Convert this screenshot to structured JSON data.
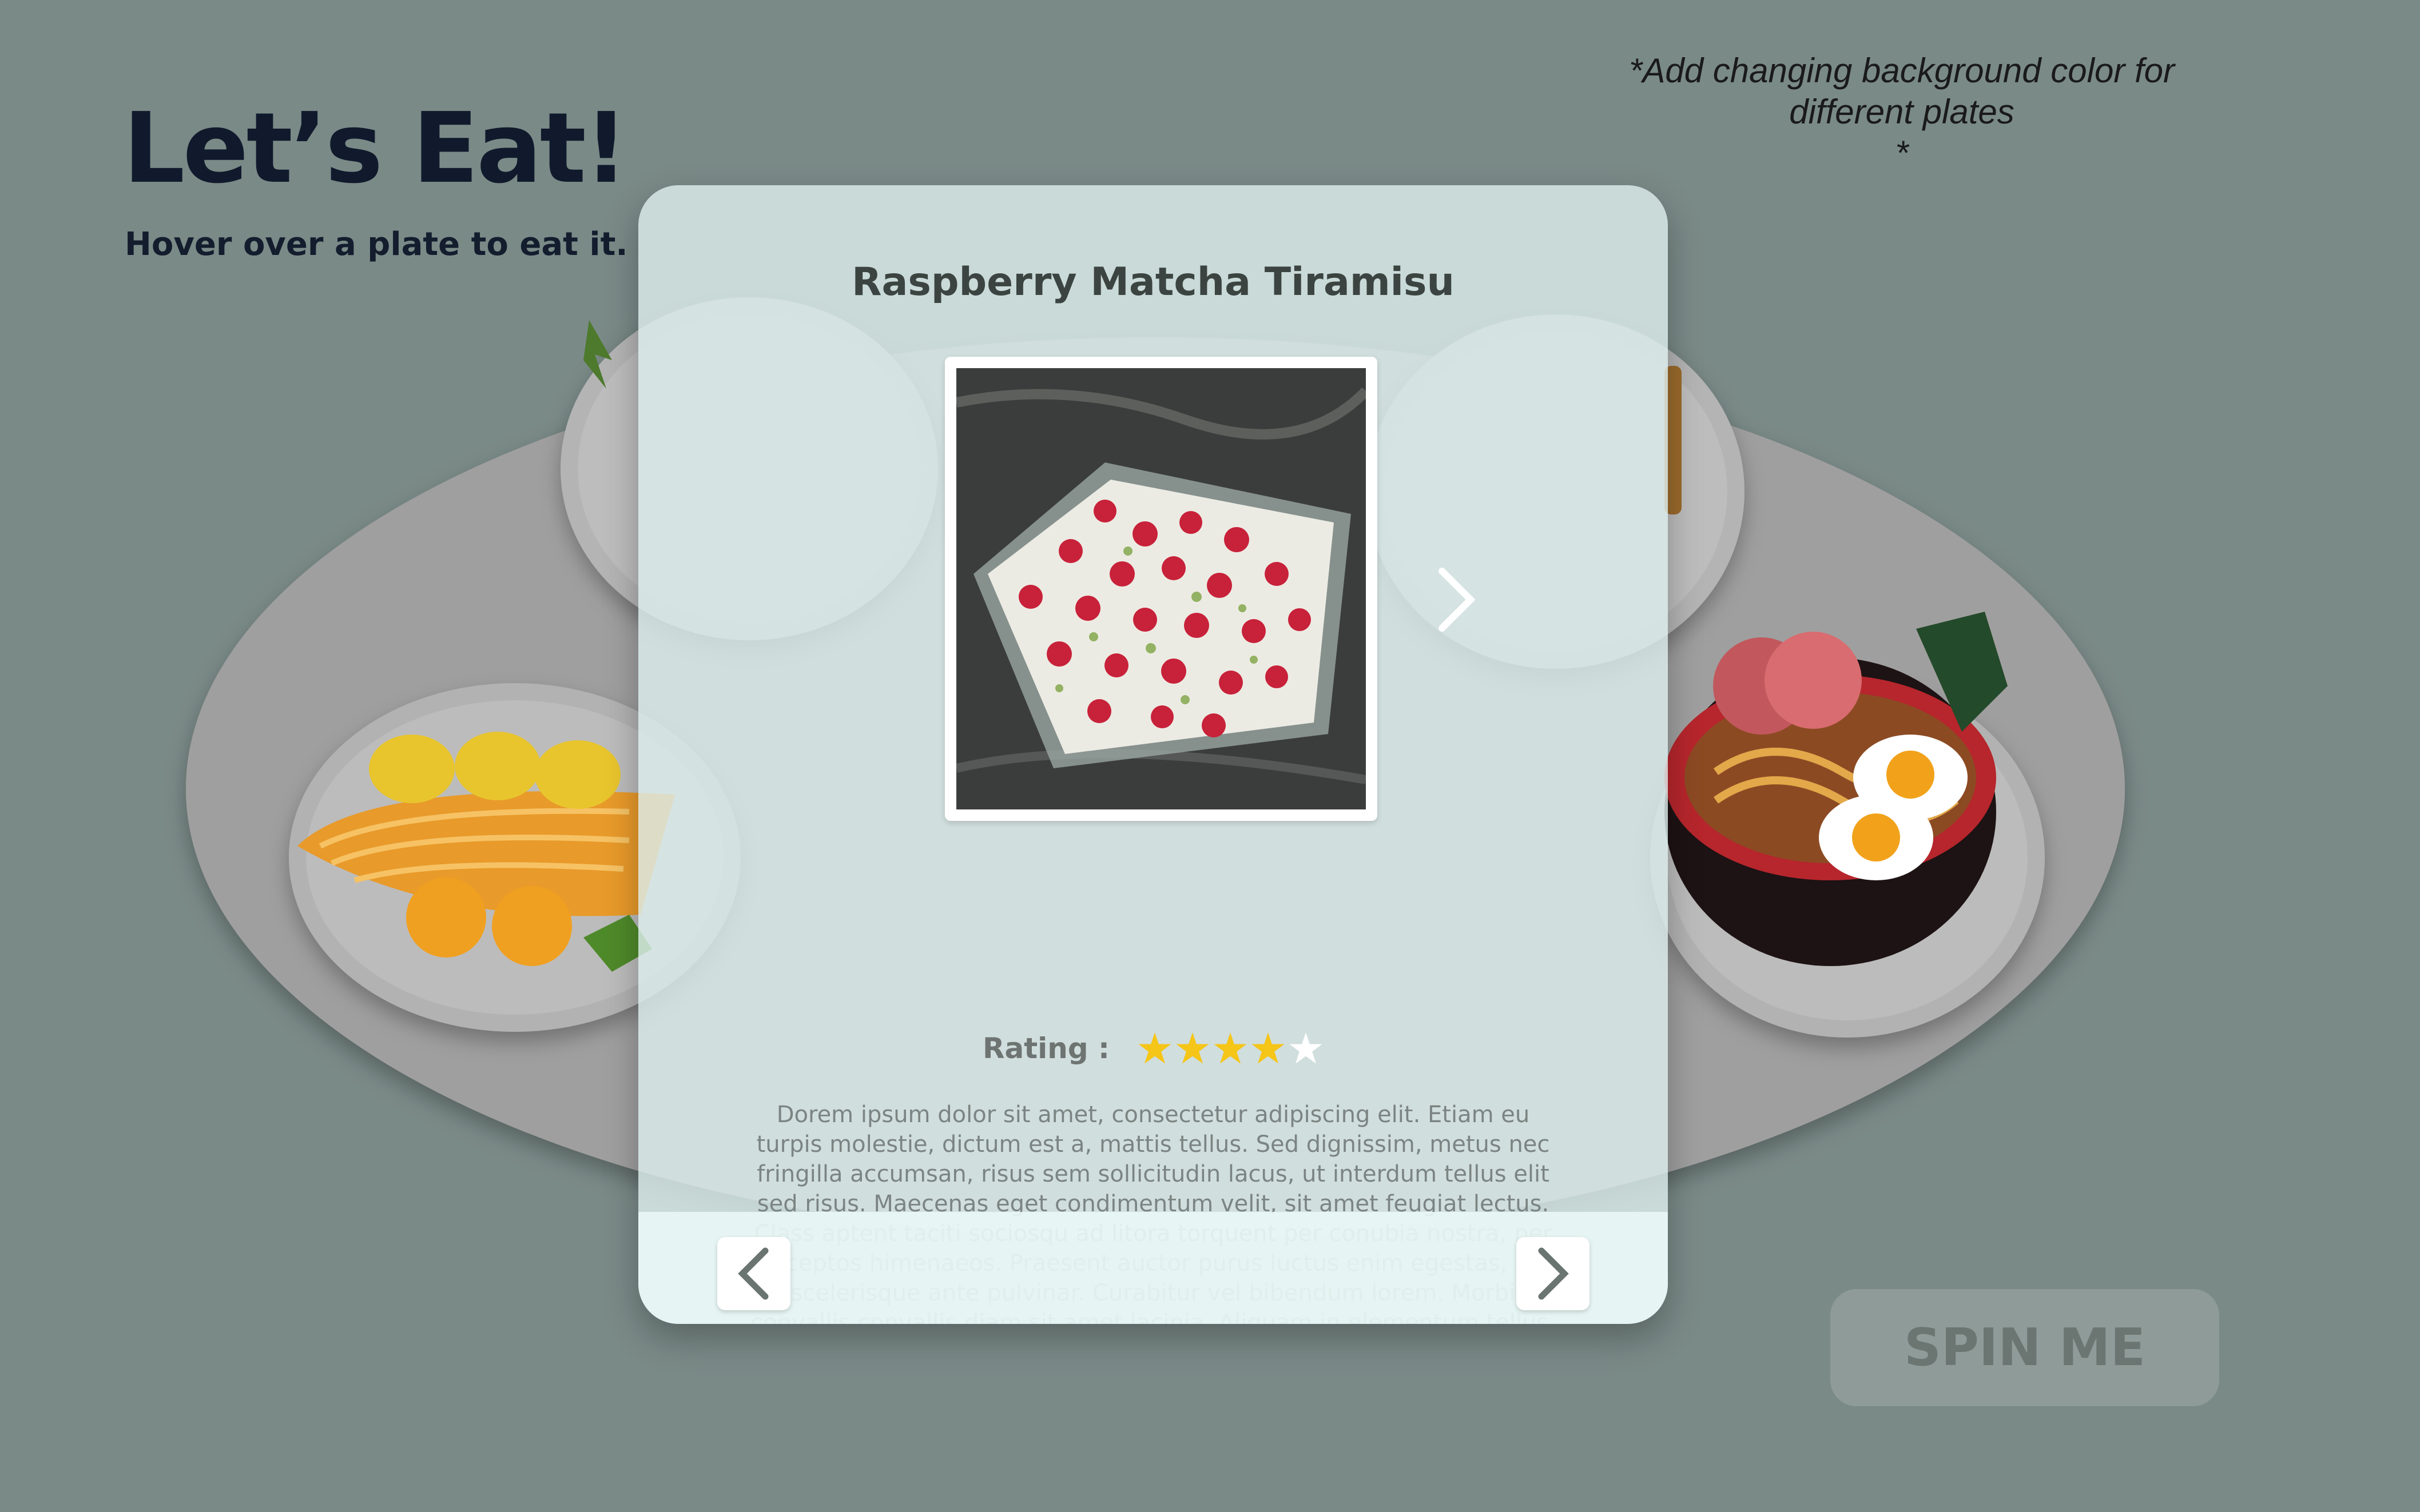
{
  "header": {
    "title": "Let’s Eat!",
    "subtitle": "Hover over a plate to eat it."
  },
  "note": {
    "line1": "*Add changing background color for",
    "line2": "different plates",
    "line3": "*"
  },
  "modal": {
    "dish_name": "Raspberry Matcha Tiramisu",
    "rating_label": "Rating :",
    "rating_value": 4,
    "rating_max": 5,
    "description": "Dorem ipsum dolor sit amet, consectetur adipiscing elit. Etiam eu turpis molestie, dictum est a, mattis tellus. Sed dignissim, metus nec fringilla accumsan, risus sem sollicitudin lacus, ut interdum tellus elit sed risus. Maecenas eget condimentum velit, sit amet feugiat lectus. Class aptent taciti sociosqu ad litora torquent per conubia nostra, per inceptos himenaeos. Praesent auctor purus luctus enim egestas, ac scelerisque ante pulvinar. Curabitur vel bibendum lorem. Morbi convallis convallis diam sit amet lacinia. Aliquam in elementum tellus."
  },
  "spin_button": {
    "label": "SPIN ME"
  },
  "colors": {
    "background": "#7a8a87",
    "star_filled": "#f5c518",
    "star_empty": "#ffffff",
    "raspberry": "#c8213a",
    "matcha": "#6e9a2c"
  },
  "icons": {
    "prev": "chevron-left-icon",
    "next": "chevron-right-icon",
    "photo_next": "chevron-right-icon",
    "star": "star-icon"
  }
}
